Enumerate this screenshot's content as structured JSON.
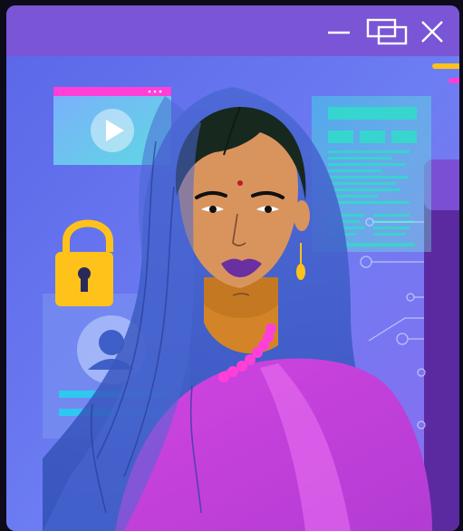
{
  "window": {
    "controls": [
      {
        "name": "minimize",
        "icon": "minimize-icon"
      },
      {
        "name": "restore",
        "icon": "restore-icon"
      },
      {
        "name": "close",
        "icon": "close-icon"
      }
    ]
  },
  "palette": {
    "titlebar": "#7a55d6",
    "background_top": "#5b63e6",
    "background_bottom": "#8a6ff0",
    "accent_pink": "#ff3fd8",
    "accent_teal": "#2de0c8",
    "accent_yellow": "#ffc21a",
    "skin": "#d88a5a",
    "scarf": "#3f5fc8",
    "sari": "#c93fd8"
  },
  "icons": [
    "play-icon",
    "padlock-icon",
    "user-avatar-icon"
  ]
}
